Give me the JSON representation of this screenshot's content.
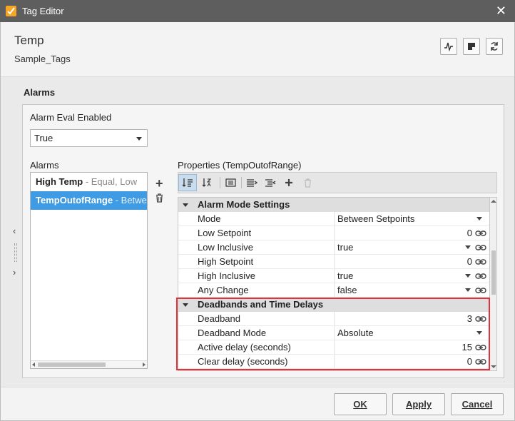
{
  "window": {
    "title": "Tag Editor",
    "close": "✕"
  },
  "header": {
    "tag_name": "Temp",
    "provider": "Sample_Tags"
  },
  "section": {
    "title": "Alarms"
  },
  "alarm_eval": {
    "label": "Alarm Eval Enabled",
    "value": "True"
  },
  "alarms": {
    "label": "Alarms",
    "items": [
      {
        "name": "High Temp",
        "desc": " - Equal, Low"
      },
      {
        "name": "TempOutofRange",
        "desc": " - Betwee"
      }
    ]
  },
  "properties": {
    "label": "Properties (TempOutofRange)",
    "categories": [
      {
        "title": "Alarm Mode Settings",
        "rows": [
          {
            "name": "Mode",
            "value": "Between Setpoints"
          },
          {
            "name": "Low Setpoint",
            "value": "0"
          },
          {
            "name": "Low Inclusive",
            "value": "true"
          },
          {
            "name": "High Setpoint",
            "value": "0"
          },
          {
            "name": "High Inclusive",
            "value": "true"
          },
          {
            "name": "Any Change",
            "value": "false"
          }
        ]
      },
      {
        "title": "Deadbands and Time Delays",
        "rows": [
          {
            "name": "Deadband",
            "value": "3"
          },
          {
            "name": "Deadband Mode",
            "value": "Absolute"
          },
          {
            "name": "Active delay (seconds)",
            "value": "15"
          },
          {
            "name": "Clear delay (seconds)",
            "value": "0"
          }
        ]
      }
    ]
  },
  "buttons": {
    "ok": "OK",
    "apply": "Apply",
    "cancel": "Cancel"
  },
  "side": {
    "left": "‹",
    "right": "›"
  },
  "colors": {
    "selection": "#3e9be4",
    "highlight": "#e0343c",
    "titlebar": "#5e5e5e",
    "app_icon": "#f6a623"
  }
}
